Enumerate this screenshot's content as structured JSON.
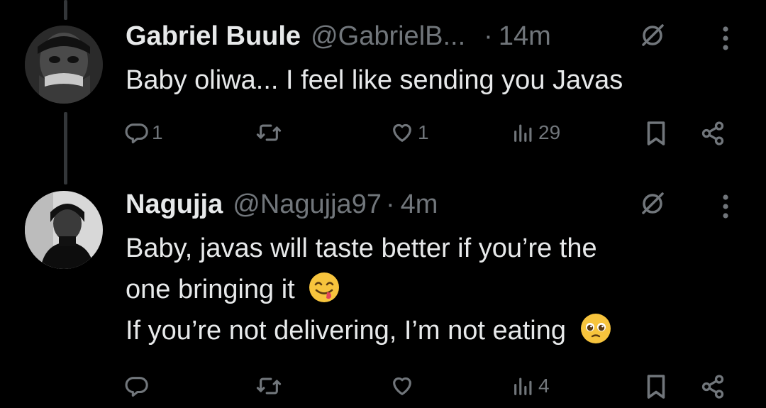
{
  "tweets": [
    {
      "display_name": "Gabriel Buule",
      "handle": "@GabrielB...",
      "separator": "·",
      "time": "14m",
      "lines": [
        "Baby oliwa... I feel like sending you Javas"
      ],
      "actions": {
        "reply_count": "1",
        "retweet_count": "",
        "like_count": "1",
        "views_count": "29"
      }
    },
    {
      "display_name": "Nagujja",
      "handle": "@Nagujja97",
      "separator": "·",
      "time": "4m",
      "lines": [
        "Baby,  javas will taste better if you’re the",
        "one bringing it",
        "If you’re not delivering, I’m not eating"
      ],
      "actions": {
        "reply_count": "",
        "retweet_count": "",
        "like_count": "",
        "views_count": "4"
      }
    }
  ],
  "icons": {
    "reply": "reply-icon",
    "retweet": "retweet-icon",
    "like": "heart-icon",
    "views": "views-icon",
    "bookmark": "bookmark-icon",
    "share": "share-icon",
    "grok": "grok-icon",
    "more": "more-icon"
  },
  "colors": {
    "background": "#000000",
    "text": "#e7e9ea",
    "secondary": "#71767b",
    "thread_line": "#333639"
  }
}
